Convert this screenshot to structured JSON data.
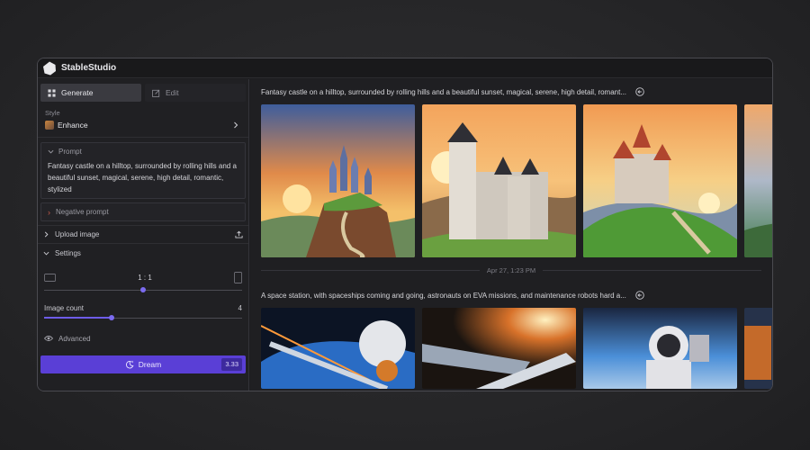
{
  "app": {
    "title": "StableStudio"
  },
  "tabs": [
    {
      "label": "Generate",
      "icon": "sparkle-grid-icon",
      "active": true
    },
    {
      "label": "Edit",
      "icon": "pencil-square-icon",
      "active": false
    }
  ],
  "style": {
    "label": "Style",
    "value": "Enhance"
  },
  "prompt": {
    "label": "Prompt",
    "text": "Fantasy castle on a hilltop, surrounded by rolling hills and a beautiful sunset, magical, serene, high detail, romantic, stylized"
  },
  "negative_prompt": {
    "label": "Negative prompt"
  },
  "upload": {
    "label": "Upload image"
  },
  "settings": {
    "label": "Settings",
    "aspect_ratio": "1 : 1",
    "aspect_ratio_level": 0.5,
    "image_count_label": "Image count",
    "image_count": "4",
    "image_count_level": 0.34,
    "advanced_label": "Advanced"
  },
  "dream": {
    "label": "Dream",
    "cost": "3.33",
    "color": "#5a3fd6"
  },
  "generations": [
    {
      "prompt": "Fantasy castle on a hilltop, surrounded by rolling hills and a beautiful sunset, magical, serene, high detail, romant...",
      "timestamp": "Apr 27, 1:23 PM"
    },
    {
      "prompt": "A space station, with spaceships coming and going, astronauts on EVA missions, and maintenance robots hard a..."
    }
  ],
  "colors": {
    "accent": "#6d5ce8",
    "background": "#1c1c1f"
  }
}
